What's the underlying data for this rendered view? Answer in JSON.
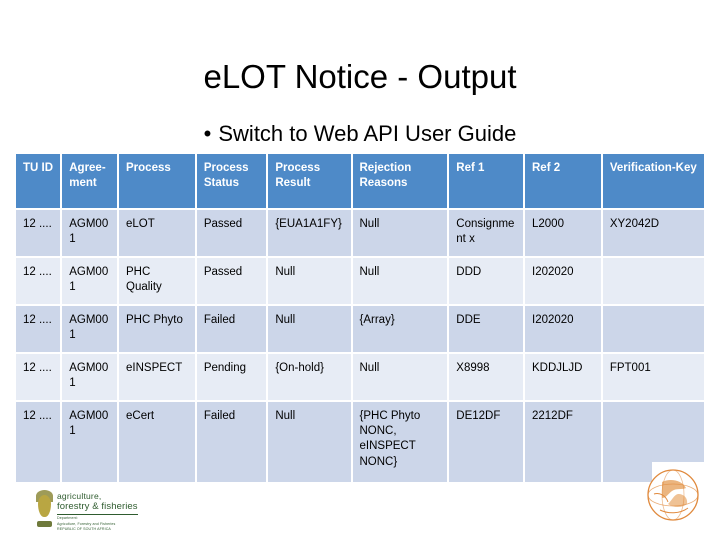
{
  "slide": {
    "title": "eLOT Notice - Output",
    "bullet_marker": "•",
    "bullet_text": "Switch to Web API User Guide"
  },
  "table": {
    "headers": [
      "TU ID",
      "Agree-ment",
      "Process",
      "Process Status",
      "Process Result",
      "Rejection Reasons",
      "Ref 1",
      "Ref 2",
      "Verification-Key"
    ],
    "rows": [
      {
        "tu_id": "12 ....",
        "agreement": "AGM001",
        "process": "eLOT",
        "process_status": "Passed",
        "process_result": "{EUA1A1FY}",
        "rejection_reasons": "Null",
        "ref1": "Consignment x",
        "ref2": "L2000",
        "verification_key": "XY2042D"
      },
      {
        "tu_id": "12 ....",
        "agreement": "AGM001",
        "process": "PHC Quality",
        "process_status": "Passed",
        "process_result": "Null",
        "rejection_reasons": "Null",
        "ref1": "DDD",
        "ref2": "I202020",
        "verification_key": ""
      },
      {
        "tu_id": "12 ....",
        "agreement": "AGM001",
        "process": "PHC Phyto",
        "process_status": "Failed",
        "process_result": "Null",
        "rejection_reasons": "{Array}",
        "ref1": "DDE",
        "ref2": "I202020",
        "verification_key": ""
      },
      {
        "tu_id": "12 ....",
        "agreement": "AGM001",
        "process": "eINSPECT",
        "process_status": "Pending",
        "process_result": "{On-hold}",
        "rejection_reasons": "Null",
        "ref1": "X8998",
        "ref2": "KDDJLJD",
        "verification_key": "FPT001"
      },
      {
        "tu_id": "12 ....",
        "agreement": "AGM001",
        "process": "eCert",
        "process_status": "Failed",
        "process_result": "Null",
        "rejection_reasons": "{PHC Phyto NONC, eINSPECT NONC}",
        "ref1": "DE12DF",
        "ref2": "2212DF",
        "verification_key": ""
      }
    ]
  },
  "footer": {
    "dept_logo": {
      "line1": "agriculture,",
      "line2": "forestry & fisheries",
      "sub1": "Department:",
      "sub2": "Agriculture, Forestry and Fisheries",
      "sub3": "REPUBLIC OF SOUTH AFRICA"
    },
    "globe_logo_name": "globe-logo"
  },
  "colors": {
    "header_blue": "#4e8ac8",
    "row_a": "#ccd6e9",
    "row_b": "#e7ecf5",
    "dept_green": "#2f5c2f",
    "globe_orange": "#e0893c"
  }
}
